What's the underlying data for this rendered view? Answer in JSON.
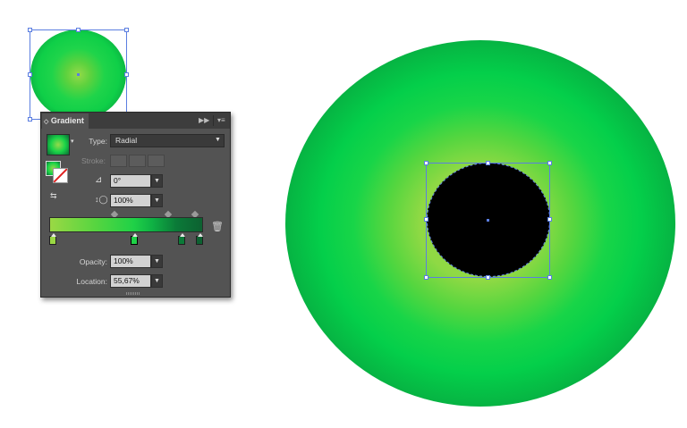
{
  "panel": {
    "title": "Gradient",
    "collapse_icon": "double-arrow-icon",
    "menu_icon": "panel-menu-icon",
    "type_label": "Type:",
    "type_value": "Radial",
    "stroke_label": "Stroke:",
    "angle_value": "0°",
    "aspect_value": "100%",
    "opacity_label": "Opacity:",
    "opacity_value": "100%",
    "location_label": "Location:",
    "location_value": "55,67%",
    "gradient_stops": [
      {
        "location_percent": 0,
        "color": "#9ad844",
        "selected": false
      },
      {
        "location_percent": 55.67,
        "color": "#1fd147",
        "selected": true
      },
      {
        "location_percent": 88,
        "color": "#0b7a38",
        "selected": false
      },
      {
        "location_percent": 100,
        "color": "#0d6131",
        "selected": false
      }
    ]
  },
  "colors": {
    "selection": "#5b7ee0",
    "panel_bg": "#535353",
    "gradient_light": "#9ad844",
    "gradient_mid": "#1fd147",
    "gradient_dark": "#0d6131"
  }
}
